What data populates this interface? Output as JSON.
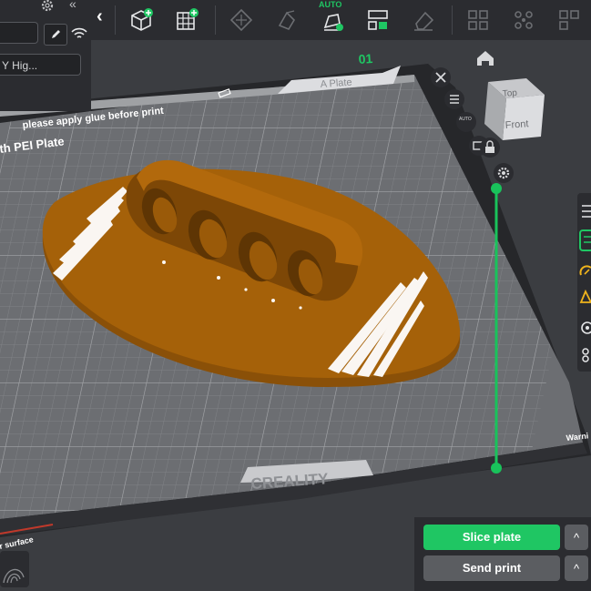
{
  "toolbar": {
    "collapse_label": "‹",
    "auto_label": "AUTO",
    "icons": [
      "add-object-icon",
      "add-plate-icon",
      "auto-orient-icon",
      "arrange-icon",
      "auto-arrange-icon",
      "split-view-icon",
      "erase-icon",
      "layout-icon",
      "snap-icon",
      "more-icon"
    ]
  },
  "sidebar": {
    "settings_icon": "gear-icon",
    "collapse_label": "«",
    "printer_field": "",
    "edit_icon": "pencil-icon",
    "wifi_icon": "wifi-icon",
    "process_field": "Y Hig..."
  },
  "plate": {
    "number": "01",
    "name": "A Plate",
    "glue_notice": "please apply glue before print",
    "surface_label": "th PEI Plate",
    "brand": "CREALITY",
    "bottom_label": "r surface",
    "right_label": "Warni"
  },
  "plate_tools": {
    "close_icon": "close-icon",
    "list_icon": "list-icon",
    "auto_icon_label": "AUTO",
    "settings_icon": "plate-settings-icon",
    "lock_icon": "lock-icon",
    "gear_icon": "gear-icon"
  },
  "view_cube": {
    "home_icon": "home-icon",
    "top_label": "Top",
    "front_label": "Front"
  },
  "actions": {
    "slice_label": "Slice plate",
    "send_label": "Send print",
    "expand_label": "^",
    "colors": {
      "slice": "#1fc663",
      "send": "#5b5d61",
      "model": "#a56109",
      "slider": "#19c35b"
    }
  }
}
